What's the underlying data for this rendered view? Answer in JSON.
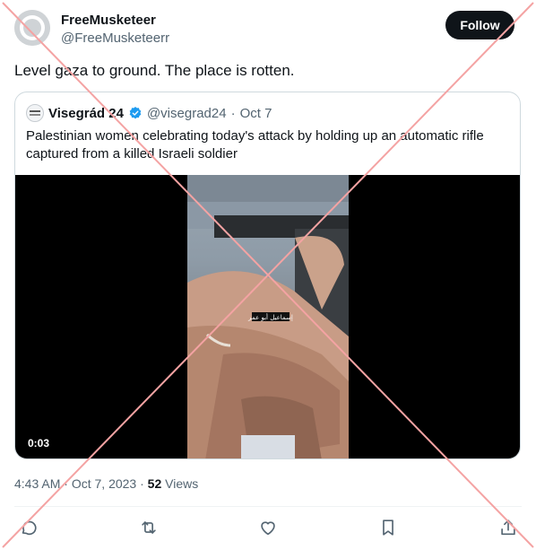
{
  "author": {
    "display_name": "FreeMusketeer",
    "handle": "@FreeMusketeerr",
    "avatar": "default-avatar-icon"
  },
  "follow_button": {
    "label": "Follow"
  },
  "tweet": {
    "text": "Level gaza to ground. The place is rotten."
  },
  "quoted_tweet": {
    "display_name": "Visegrád 24",
    "verified_icon": "verified-badge-icon",
    "handle": "@visegrad24",
    "separator": "·",
    "date": "Oct 7",
    "text": "Palestinian women celebrating today's attack by holding up an automatic rifle captured from a killed Israeli soldier",
    "video": {
      "duration": "0:03",
      "overlay_caption": "إسماعيل أبو عمر"
    }
  },
  "meta": {
    "time": "4:43 AM",
    "separator": "·",
    "date": "Oct 7, 2023",
    "views_count": "52",
    "views_label": "Views"
  },
  "actions": [
    "reply-icon",
    "retweet-icon",
    "like-icon",
    "bookmark-icon",
    "share-icon"
  ],
  "colors": {
    "accent": "#0f1419",
    "verified": "#1d9bf0",
    "muted": "#536471",
    "x_mark": "#f4a3a3"
  }
}
